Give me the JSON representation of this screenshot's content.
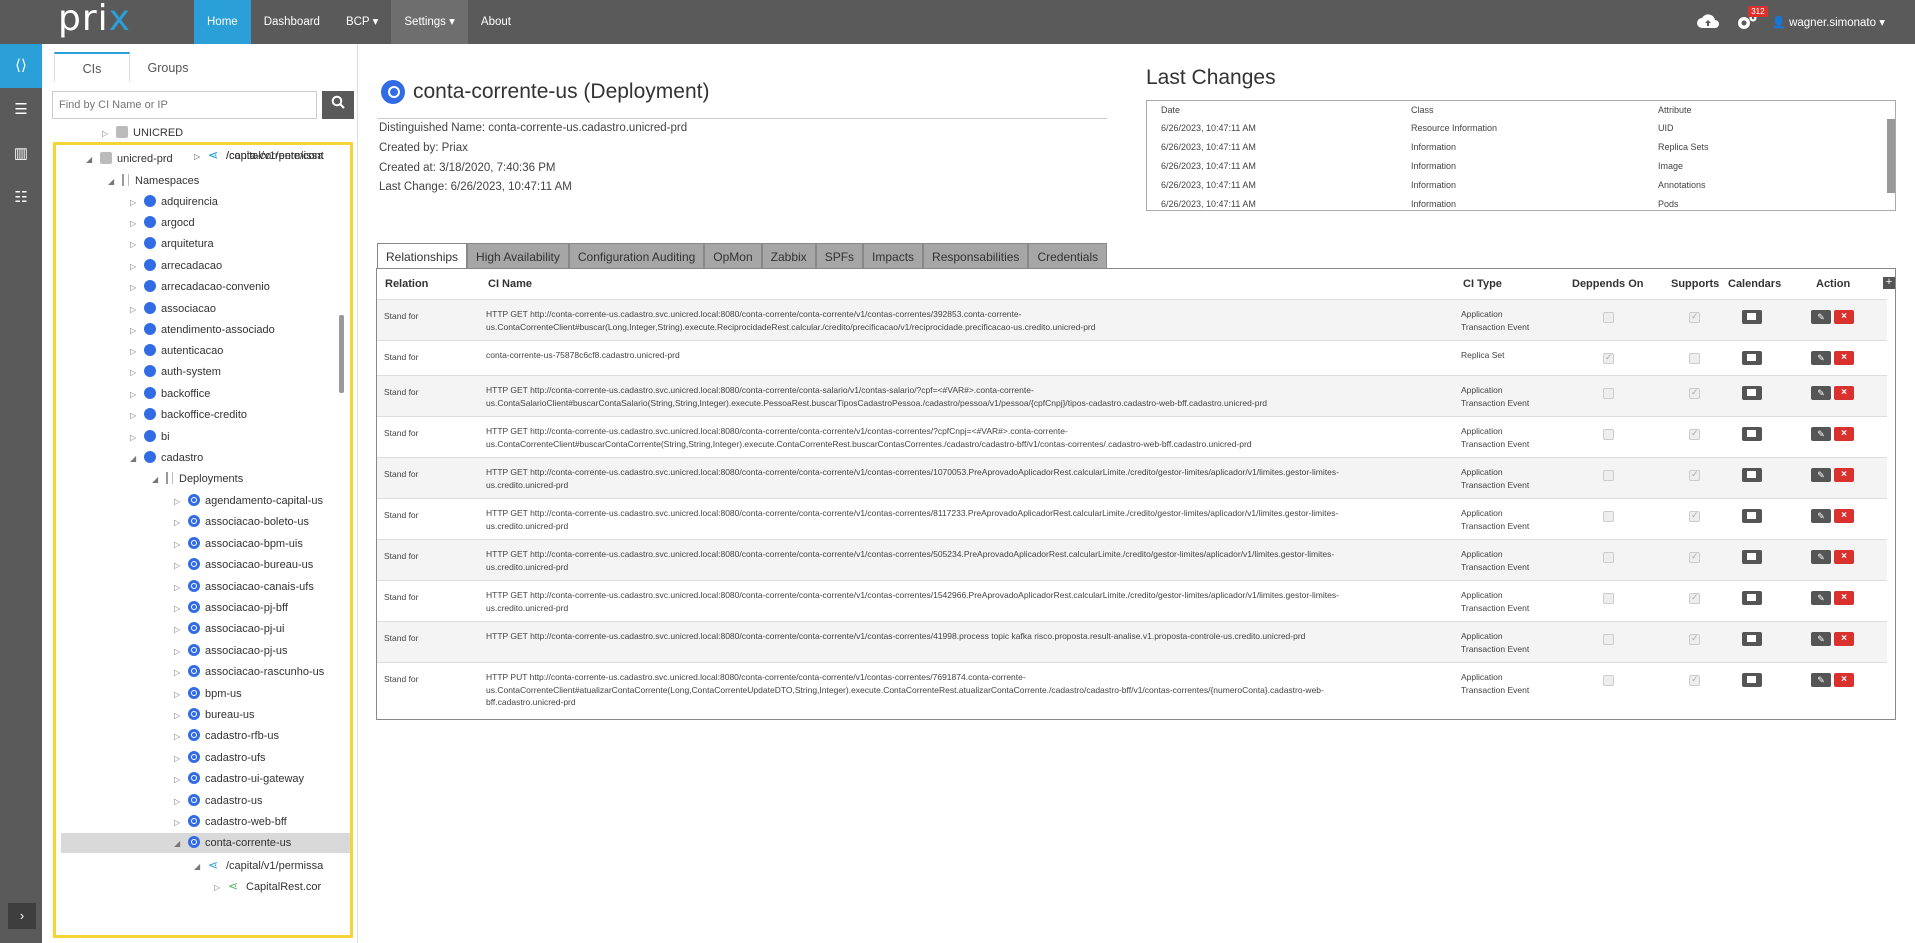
{
  "app": {
    "logo_pre": "pri",
    "logo_x": "x"
  },
  "nav": [
    {
      "label": "Home"
    },
    {
      "label": "Dashboard"
    },
    {
      "label": "BCP"
    },
    {
      "label": "Settings"
    },
    {
      "label": "About"
    }
  ],
  "header": {
    "badge": "312",
    "user": "wagner.simonato"
  },
  "left": {
    "tabs": [
      "CIs",
      "Groups"
    ],
    "search_placeholder": "Find by CI Name or IP",
    "above": "UNICRED",
    "tree": [
      {
        "label": "unicred-prd",
        "icon": "cube",
        "open": true,
        "depth": 0
      },
      {
        "label": "Namespaces",
        "icon": "book",
        "open": true,
        "depth": 1
      },
      {
        "label": "adquirencia",
        "icon": "ns",
        "depth": 2
      },
      {
        "label": "argocd",
        "icon": "ns",
        "depth": 2
      },
      {
        "label": "arquitetura",
        "icon": "ns",
        "depth": 2
      },
      {
        "label": "arrecadacao",
        "icon": "ns",
        "depth": 2
      },
      {
        "label": "arrecadacao-convenio",
        "icon": "ns",
        "depth": 2
      },
      {
        "label": "associacao",
        "icon": "ns",
        "depth": 2
      },
      {
        "label": "atendimento-associado",
        "icon": "ns",
        "depth": 2
      },
      {
        "label": "autenticacao",
        "icon": "ns",
        "depth": 2
      },
      {
        "label": "auth-system",
        "icon": "ns",
        "depth": 2
      },
      {
        "label": "backoffice",
        "icon": "ns",
        "depth": 2
      },
      {
        "label": "backoffice-credito",
        "icon": "ns",
        "depth": 2
      },
      {
        "label": "bi",
        "icon": "ns",
        "depth": 2
      },
      {
        "label": "cadastro",
        "icon": "ns",
        "open": true,
        "depth": 2
      },
      {
        "label": "Deployments",
        "icon": "book",
        "open": true,
        "depth": 3
      },
      {
        "label": "agendamento-capital-us",
        "icon": "dep",
        "depth": 4
      },
      {
        "label": "associacao-boleto-us",
        "icon": "dep",
        "depth": 4
      },
      {
        "label": "associacao-bpm-uis",
        "icon": "dep",
        "depth": 4
      },
      {
        "label": "associacao-bureau-us",
        "icon": "dep",
        "depth": 4
      },
      {
        "label": "associacao-canais-ufs",
        "icon": "dep",
        "depth": 4
      },
      {
        "label": "associacao-pj-bff",
        "icon": "dep",
        "depth": 4
      },
      {
        "label": "associacao-pj-ui",
        "icon": "dep",
        "depth": 4
      },
      {
        "label": "associacao-pj-us",
        "icon": "dep",
        "depth": 4
      },
      {
        "label": "associacao-rascunho-us",
        "icon": "dep",
        "depth": 4
      },
      {
        "label": "bpm-us",
        "icon": "dep",
        "depth": 4
      },
      {
        "label": "bureau-us",
        "icon": "dep",
        "depth": 4
      },
      {
        "label": "cadastro-rfb-us",
        "icon": "dep",
        "depth": 4
      },
      {
        "label": "cadastro-ufs",
        "icon": "dep",
        "depth": 4
      },
      {
        "label": "cadastro-ui-gateway",
        "icon": "dep",
        "depth": 4
      },
      {
        "label": "cadastro-us",
        "icon": "dep",
        "depth": 4
      },
      {
        "label": "cadastro-web-bff",
        "icon": "dep",
        "depth": 4
      },
      {
        "label": "conta-corrente-us",
        "icon": "dep",
        "open": true,
        "selected": true,
        "depth": 4
      },
      {
        "label": "/capital/v1/permissa",
        "icon": "share",
        "open": true,
        "depth": 5
      },
      {
        "label": "CapitalRest.cor",
        "icon": "share-green",
        "depth": 6
      },
      {
        "label": "/capital/v1/permissa",
        "icon": "share",
        "depth": 5
      },
      {
        "label": "/conta-corrente/cont",
        "icon": "share",
        "depth": 5
      }
    ]
  },
  "ci": {
    "title": "conta-corrente-us (Deployment)",
    "distinguished_name": "Distinguished Name: conta-corrente-us.cadastro.unicred-prd",
    "created_by": "Created by: Priax",
    "created_at": "Created at: 3/18/2020, 7:40:36 PM",
    "last_change": "Last Change: 6/26/2023, 10:47:11 AM"
  },
  "last_changes": {
    "title": "Last Changes",
    "headers": [
      "Date",
      "Class",
      "Attribute"
    ],
    "rows": [
      [
        "6/26/2023, 10:47:11 AM",
        "Resource Information",
        "UID"
      ],
      [
        "6/26/2023, 10:47:11 AM",
        "Information",
        "Replica Sets"
      ],
      [
        "6/26/2023, 10:47:11 AM",
        "Information",
        "Image"
      ],
      [
        "6/26/2023, 10:47:11 AM",
        "Information",
        "Annotations"
      ],
      [
        "6/26/2023, 10:47:11 AM",
        "Information",
        "Pods"
      ]
    ]
  },
  "rel_tabs": [
    "Relationships",
    "High Availability",
    "Configuration Auditing",
    "OpMon",
    "Zabbix",
    "SPFs",
    "Impacts",
    "Responsabilities",
    "Credentials"
  ],
  "rel_headers": [
    "Relation",
    "CI Name",
    "CI Type",
    "Deppends On",
    "Supports",
    "Calendars",
    "Action"
  ],
  "relationships": [
    {
      "relation": "Stand for",
      "name": "HTTP GET http://conta-corrente-us.cadastro.svc.unicred.local:8080/conta-corrente/conta-corrente/v1/contas-correntes/392853.conta-corrente-us.ContaCorrenteClient#buscar(Long,Integer,String).execute.ReciprocidadeRest.calcular./credito/precificacao/v1/reciprocidade.precificacao-us.credito.unicred-prd",
      "type": "Application Transaction Event",
      "depends": false,
      "supports": true
    },
    {
      "relation": "Stand for",
      "name": "conta-corrente-us-75878c6cf8.cadastro.unicred-prd",
      "type": "Replica Set",
      "depends": true,
      "supports": false
    },
    {
      "relation": "Stand for",
      "name": "HTTP GET http://conta-corrente-us.cadastro.svc.unicred.local:8080/conta-corrente/conta-salario/v1/contas-salario/?cpf=<#VAR#>.conta-corrente-us.ContaSalarioClient#buscarContaSalario(String,String,Integer).execute.PessoaRest.buscarTiposCadastroPessoa./cadastro/pessoa/v1/pessoa/{cpfCnpj}/tipos-cadastro.cadastro-web-bff.cadastro.unicred-prd",
      "type": "Application Transaction Event",
      "depends": false,
      "supports": true
    },
    {
      "relation": "Stand for",
      "name": "HTTP GET http://conta-corrente-us.cadastro.svc.unicred.local:8080/conta-corrente/conta-corrente/v1/contas-correntes/?cpfCnpj=<#VAR#>.conta-corrente-us.ContaCorrenteClient#buscarContaCorrente(String,String,Integer).execute.ContaCorrenteRest.buscarContasCorrentes./cadastro/cadastro-bff/v1/contas-correntes/.cadastro-web-bff.cadastro.unicred-prd",
      "type": "Application Transaction Event",
      "depends": false,
      "supports": true
    },
    {
      "relation": "Stand for",
      "name": "HTTP GET http://conta-corrente-us.cadastro.svc.unicred.local:8080/conta-corrente/conta-corrente/v1/contas-correntes/1070053.PreAprovadoAplicadorRest.calcularLimite./credito/gestor-limites/aplicador/v1/limites.gestor-limites-us.credito.unicred-prd",
      "type": "Application Transaction Event",
      "depends": false,
      "supports": true
    },
    {
      "relation": "Stand for",
      "name": "HTTP GET http://conta-corrente-us.cadastro.svc.unicred.local:8080/conta-corrente/conta-corrente/v1/contas-correntes/8117233.PreAprovadoAplicadorRest.calcularLimite./credito/gestor-limites/aplicador/v1/limites.gestor-limites-us.credito.unicred-prd",
      "type": "Application Transaction Event",
      "depends": false,
      "supports": true
    },
    {
      "relation": "Stand for",
      "name": "HTTP GET http://conta-corrente-us.cadastro.svc.unicred.local:8080/conta-corrente/conta-corrente/v1/contas-correntes/505234.PreAprovadoAplicadorRest.calcularLimite./credito/gestor-limites/aplicador/v1/limites.gestor-limites-us.credito.unicred-prd",
      "type": "Application Transaction Event",
      "depends": false,
      "supports": true
    },
    {
      "relation": "Stand for",
      "name": "HTTP GET http://conta-corrente-us.cadastro.svc.unicred.local:8080/conta-corrente/conta-corrente/v1/contas-correntes/1542966.PreAprovadoAplicadorRest.calcularLimite./credito/gestor-limites/aplicador/v1/limites.gestor-limites-us.credito.unicred-prd",
      "type": "Application Transaction Event",
      "depends": false,
      "supports": true
    },
    {
      "relation": "Stand for",
      "name": "HTTP GET http://conta-corrente-us.cadastro.svc.unicred.local:8080/conta-corrente/conta-corrente/v1/contas-correntes/41998.process topic kafka risco.proposta.result-analise.v1.proposta-controle-us.credito.unicred-prd",
      "type": "Application Transaction Event",
      "depends": false,
      "supports": true
    },
    {
      "relation": "Stand for",
      "name": "HTTP PUT http://conta-corrente-us.cadastro.svc.unicred.local:8080/conta-corrente/conta-corrente/v1/contas-correntes/7691874.conta-corrente-us.ContaCorrenteClient#atualizarContaCorrente(Long,ContaCorrenteUpdateDTO,String,Integer).execute.ContaCorrenteRest.atualizarContaCorrente./cadastro/cadastro-bff/v1/contas-correntes/{numeroConta}.cadastro-web-bff.cadastro.unicred-prd",
      "type": "Application Transaction Event",
      "depends": false,
      "supports": true
    }
  ],
  "colors": {
    "accent": "#2a9fd8",
    "topbar": "#5a5a5a",
    "highlight": "#f4d535",
    "danger": "#d9322e"
  }
}
